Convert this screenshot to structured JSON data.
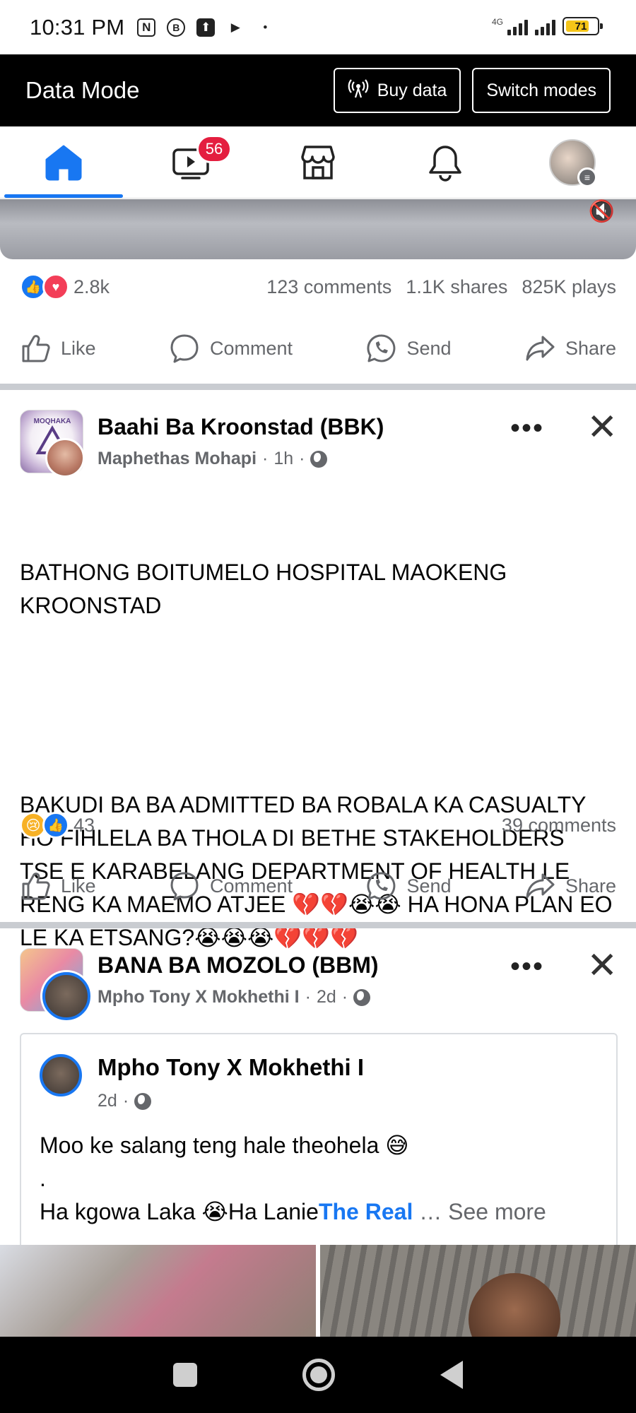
{
  "status_bar": {
    "time": "10:31 PM",
    "network": "4G",
    "battery": "71"
  },
  "data_bar": {
    "title": "Data Mode",
    "buy_data": "Buy data",
    "switch_modes": "Switch modes"
  },
  "nav": {
    "video_badge": "56"
  },
  "post0": {
    "reactions_count": "2.8k",
    "comments": "123 comments",
    "shares": "1.1K shares",
    "plays": "825K plays"
  },
  "actions": {
    "like": "Like",
    "comment": "Comment",
    "send": "Send",
    "share": "Share"
  },
  "post1": {
    "group": "Baahi Ba Kroonstad (BBK)",
    "author": "Maphethas Mohapi",
    "time": "1h",
    "text_line1": "BATHONG BOITUMELO HOSPITAL MAOKENG KROONSTAD",
    "text_body": "BAKUDI BA BA ADMITTED BA ROBALA KA CASUALTY HO FIHLELA BA THOLA DI BETHE STAKEHOLDERS TSE E KARABELANG DEPARTMENT OF HEALTH LE RENG KA MAEMO ATJEE 💔💔😭😭 HA HONA PLAN EO LE KA ETSANG?😭😭😭💔💔💔",
    "reactions_count": "43",
    "comments": "39 comments"
  },
  "post2": {
    "group": "BANA BA MOZOLO (BBM)",
    "author": "Mpho Tony X Mokhethi I",
    "time": "2d",
    "shared_author": "Mpho Tony X Mokhethi I",
    "shared_time": "2d",
    "shared_line1": "Moo ke salang teng hale theohela 😅",
    "shared_line2": ".",
    "shared_line3_prefix": "Ha kgowa Laka 😭Ha Lanie",
    "shared_line3_link": "The Real",
    "shared_line3_more": " … See more"
  },
  "colors": {
    "accent": "#1877f2",
    "badge": "#e41e3f",
    "text_secondary": "#65676b"
  }
}
